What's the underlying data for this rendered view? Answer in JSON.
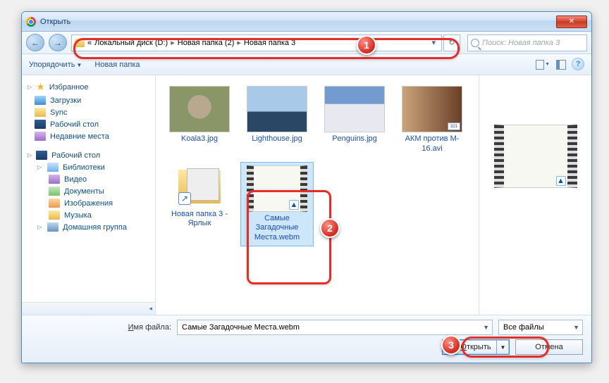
{
  "window": {
    "title": "Открыть"
  },
  "nav": {
    "breadcrumb_prefix": "«",
    "breadcrumbs": [
      "Локальный диск (D:)",
      "Новая папка (2)",
      "Новая папка 3"
    ],
    "search_placeholder": "Поиск: Новая папка 3"
  },
  "toolbar": {
    "organize": "Упорядочить",
    "new_folder": "Новая папка"
  },
  "sidebar": {
    "favorites": {
      "label": "Избранное",
      "items": [
        "Загрузки",
        "Sync",
        "Рабочий стол",
        "Недавние места"
      ]
    },
    "desktop": {
      "label": "Рабочий стол",
      "libraries": {
        "label": "Библиотеки",
        "items": [
          "Видео",
          "Документы",
          "Изображения",
          "Музыка"
        ]
      },
      "homegroup": "Домашняя группа"
    }
  },
  "files": [
    {
      "name": "Koala3.jpg"
    },
    {
      "name": "Lighthouse.jpg"
    },
    {
      "name": "Penguins.jpg"
    },
    {
      "name": "АКМ против M-16.avi",
      "mpc": "321"
    },
    {
      "name": "Новая папка 3 - Ярлык"
    },
    {
      "name": "Самые Загадочные Места.webm",
      "selected": true
    }
  ],
  "footer": {
    "filename_label": "Имя файла:",
    "filename_value": "Самые Загадочные Места.webm",
    "filter": "Все файлы",
    "open_label": "Открыть",
    "cancel_label": "Отмена"
  },
  "callouts": {
    "1": "1",
    "2": "2",
    "3": "3"
  }
}
